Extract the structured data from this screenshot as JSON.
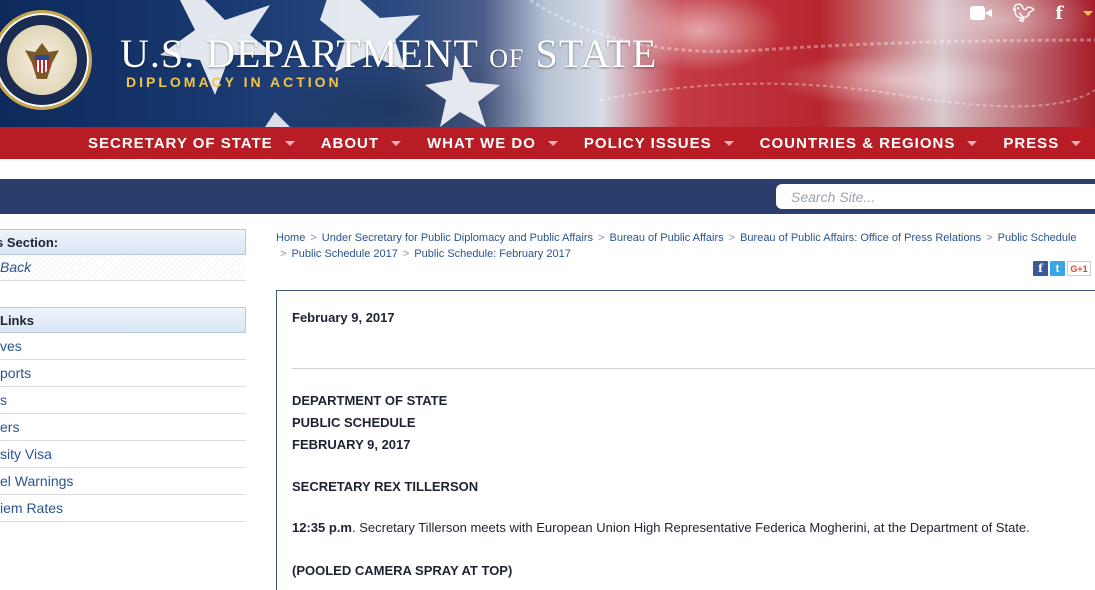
{
  "header": {
    "title_main": "U.S. DEPARTMENT",
    "title_of": "OF",
    "title_state": "STATE",
    "tagline": "DIPLOMACY IN ACTION",
    "seal_text": "UNITED STATES OF AMERICA",
    "social_icons": [
      "video-camera-icon",
      "twitter-icon",
      "facebook-icon"
    ]
  },
  "nav": {
    "items": [
      {
        "label": "SECRETARY OF STATE"
      },
      {
        "label": "ABOUT"
      },
      {
        "label": "WHAT WE DO"
      },
      {
        "label": "POLICY ISSUES"
      },
      {
        "label": "COUNTRIES & REGIONS"
      },
      {
        "label": "PRESS"
      }
    ]
  },
  "search": {
    "placeholder": "Search Site..."
  },
  "sidebar": {
    "section_header": "s Section:",
    "back_label": "Back",
    "links_header": "Links",
    "links": [
      "ves",
      "ports",
      "s",
      "ers",
      "sity Visa",
      "el Warnings",
      "iem Rates"
    ]
  },
  "breadcrumb": [
    "Home",
    "Under Secretary for Public Diplomacy and Public Affairs",
    "Bureau of Public Affairs",
    "Bureau of Public Affairs: Office of Press Relations",
    "Public Schedule",
    "Public Schedule 2017",
    "Public Schedule: February 2017"
  ],
  "share": {
    "facebook": "f",
    "twitter": "t",
    "google": "G+1"
  },
  "content": {
    "date": "February 9, 2017",
    "dept": "DEPARTMENT OF STATE",
    "schedule": "PUBLIC SCHEDULE",
    "schedule_date": "FEBRUARY 9, 2017",
    "person": "SECRETARY REX TILLERSON",
    "event_time": "12:35 p.m",
    "event_text": ". Secretary Tillerson meets with European Union High Representative Federica Mogherini, at the Department of State.",
    "note": "(POOLED CAMERA SPRAY AT TOP)"
  },
  "colors": {
    "nav_red": "#b81d25",
    "search_bar_navy": "#2b3d6a",
    "tagline_gold": "#f2c44a",
    "link_blue": "#2a5391"
  }
}
